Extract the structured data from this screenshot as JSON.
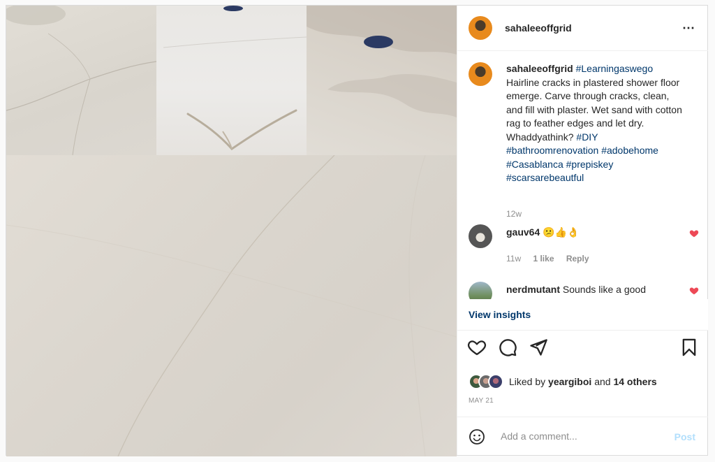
{
  "post": {
    "username": "sahaleeoffgrid",
    "more_icon": "⋯"
  },
  "caption": {
    "username": "sahaleeoffgrid",
    "tag_lead": "#Learningaswego",
    "text": "Hairline cracks in plastered shower floor emerge. Carve through cracks, clean, and fill with plaster. Wet sand with cotton rag to feather edges and let dry. Whaddyathink?",
    "tags": [
      "#DIY",
      "#bathroomrenovation",
      "#adobehome",
      "#Casablanca",
      "#prepiskey",
      "#scarsarebeautful"
    ],
    "time": "12w"
  },
  "comments": [
    {
      "username": "gauv64",
      "text": "😕👍👌",
      "time": "11w",
      "likes": "1 like",
      "reply": "Reply"
    },
    {
      "username": "nerdmutant",
      "text": "Sounds like a good"
    }
  ],
  "insights_label": "View insights",
  "likes": {
    "prefix": "Liked by",
    "user": "yeargiboi",
    "and": "and",
    "others": "14 others"
  },
  "date": "MAY 21",
  "add_comment": {
    "placeholder": "Add a comment...",
    "post_label": "Post"
  },
  "colors": {
    "link": "#00376b",
    "like_red": "#ed4956",
    "post_disabled": "#b2dffc",
    "muted": "#8e8e8e"
  }
}
